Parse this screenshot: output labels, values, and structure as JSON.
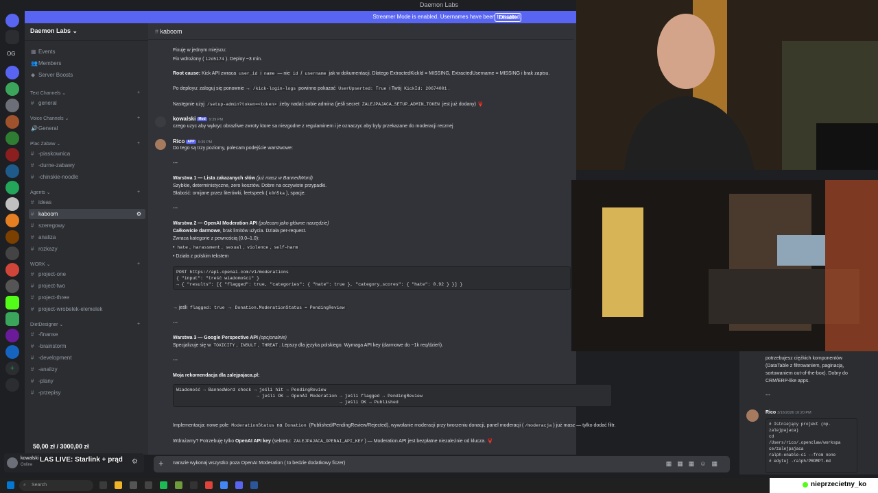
{
  "window": {
    "title": "Daemon Labs"
  },
  "streamer_bar": {
    "text": "Streamer Mode is enabled. Usernames have been truncated.",
    "disable_label": "Disable"
  },
  "rail": {
    "dm_badge": "OG"
  },
  "sidebar": {
    "server_name": "Daemon Labs",
    "top_items": [
      "Events",
      "Members",
      "Server Boosts"
    ],
    "categories": {
      "text": "Text Channels",
      "voice": "Voice Channels",
      "plac": "Plac Zabaw",
      "agents": "Agents",
      "work": "WORK",
      "diet": "DietDesigner"
    },
    "text_channels": [
      "general"
    ],
    "voice_channels": [
      "General"
    ],
    "plac_channels": [
      "-piaskownica",
      "-durne-zabawy",
      "-chinskie-noodle"
    ],
    "agent_channels": [
      "ideas",
      "kaboom",
      "szeregowy",
      "analiza",
      "rozkazy"
    ],
    "work_channels": [
      "project-one",
      "project-two",
      "project-three",
      "project-wrobelek-elemelek"
    ],
    "diet_channels": [
      "-finanse",
      "-brainstorm",
      "-development",
      "-analizy",
      "-plany",
      "-przepisy"
    ]
  },
  "channel": {
    "name": "kaboom"
  },
  "messages": {
    "l1": "Fixuję w jednym miejscu:",
    "l2a": "Fix wdrożony (",
    "l2code": "12d5174",
    "l2b": "). Deploy ~3 min.",
    "l3bold": "Root cause:",
    "l3a": " Kick API zwraca ",
    "l3c1": "user_id",
    "l3sep": " i ",
    "l3c2": "name",
    "l3b": " — nie ",
    "l3c3": "id",
    "l3sep2": " / ",
    "l3c4": "username",
    "l3c": " jak w dokumentacji. Dlatego ExtractedKickId = MISSING, ExtractedUsername = MISSING i brak zapisu.",
    "l4a": "Po deployu: zaloguj się ponownie → ",
    "l4c1": "/kick-login-logs",
    "l4b": " powinno pokazać ",
    "l4c2": "UserUpserted: True",
    "l4c": " i Twój ",
    "l4c3": "KickId: 20674001",
    "l4d": ".",
    "l5a": "Następnie użyj ",
    "l5c1": "/setup-admin?token=<token>",
    "l5b": " żeby nadać sobie admina (jeśli secret ",
    "l5c2": "ZALEJPAJACA_SETUP_ADMIN_TOKEN",
    "l5c": " jest już dodany) 🦞",
    "kowalski_name": "kowalski",
    "kowalski_badge": "Mod",
    "kowalski_time": "9:39 PM",
    "kowalski_text": "czego uzyc aby wykryc obrazliwe zwroty ktore sa niezgodne z regulaminem i je oznaczyc aby byly przekazane do moderacji recznej",
    "rico_name": "Rico",
    "rico_badge": "APP",
    "rico_time": "9:39 PM",
    "rico_intro": "Do tego są trzy poziomy, polecam podejście warstwowe:",
    "sep": "---",
    "w1_title": "Warstwa 1 — Lista zakazanych słów",
    "w1_note": " (już masz w BannedWord)",
    "w1_a": "Szybkie, deterministyczne, zero kosztów. Dobre na oczywiste przypadki.",
    "w1_b1": "Słabość: omijane przez literówki, leetspeek (",
    "w1_bcode": "k0ń5ka",
    "w1_b2": "), spacje.",
    "w2_title": "Warstwa 2 — OpenAI Moderation API",
    "w2_note": " (polecam jako główne narzędzie)",
    "w2_a_bold": "Całkowicie darmowe",
    "w2_a": ", brak limitów użycia. Działa per-request.",
    "w2_b": "Zwraca kategorie z pewnością (0.0–1.0):",
    "w2_bullet1": [
      "hate",
      "harassment",
      "sexual",
      "violence",
      "self-harm"
    ],
    "w2_bullet2": "Działa z polskim tekstem",
    "code1": "POST https://api.openai.com/v1/moderations\n{ \"input\": \"treść wiadomości\" }\n→ { \"results\": [{ \"flagged\": true, \"categories\": { \"hate\": true }, \"category_scores\": { \"hate\": 0.92 } }] }",
    "w2_flag_a": "→ jeśli ",
    "w2_flag_code": "flagged: true",
    "w2_flag_b": " → ",
    "w2_flag_code2": "Donation.ModerationStatus = PendingReview",
    "w3_title": "Warstwa 3 — Google Perspective API",
    "w3_note": " (opcjonalnie)",
    "w3_a1": "Specjalizuje się w ",
    "w3_c1": "TOXICITY",
    "w3_c2": "INSULT",
    "w3_c3": "THREAT",
    "w3_a2": ". Lepszy dla języka polskiego. Wymaga API key (darmowe do ~1k req/dzień).",
    "rec_title": "Moja rekomendacja dla zalejpajaca.pl:",
    "code2": "Wiadomość → BannedWord check → jeśli hit → PendingReview\n                              → jeśli OK → OpenAI Moderation → jeśli flagged → PendingReview\n                                                             → jeśli OK → Published",
    "impl_a": "Implementacja: nowe pole ",
    "impl_c1": "ModerationStatus",
    "impl_b": " na ",
    "impl_c2": "Donation",
    "impl_c": " (Published/PendingReview/Rejected), wywołanie moderacji przy tworzeniu donacji, panel moderacji (",
    "impl_c3": "/moderacja",
    "impl_d": ") już masz — tylko dodać filtr.",
    "last_a": "Wdrażamy? Potrzebuję tylko ",
    "last_bold": "OpenAI API key",
    "last_b": " (sekretu: ",
    "last_code": "ZALEJPAJACA_OPENAI_API_KEY",
    "last_c": ") — Moderation API jest bezpłatne niezależnie od klucza. 🦞"
  },
  "composer": {
    "text": "narazie wykonaj wszystko poza OpenAI Moderation ( to bedzie dodatkowy ficzer)"
  },
  "user_panel": {
    "name": "kowalski",
    "status": "Online"
  },
  "overlay": {
    "donation": "50,00 zł / 3000,00 zł",
    "live": "LAS LIVE: Starlink + prąd",
    "viewer": "nieprzecietny_ko"
  },
  "right_panel": {
    "t1": "potrzebujesz ciężkich komponentów",
    "t2": "(DataTable z filtrowaniem, paginacją,",
    "t3": "sortowaniem out-of-the-box). Dobry do",
    "t4": "CRM/ERP-like apps.",
    "sep": "---",
    "rico": "Rico",
    "rico_time": "3/16/2026 10:20 PM",
    "code": "# Istniejący projekt (np.\nzalejpajaca)\ncd\n/Users/rico/.openclaw/workspa\nce/zalejpajaca\nralph-enable-ci --from none\n# edytuj .ralph/PROMPT.md"
  },
  "taskbar": {
    "search": "Search"
  }
}
